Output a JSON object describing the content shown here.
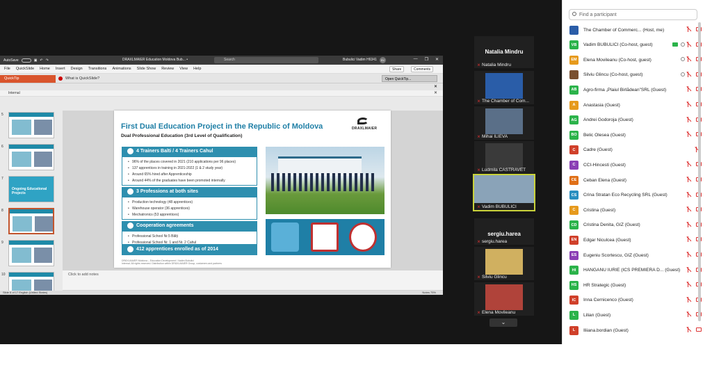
{
  "ppt": {
    "autosave": "AutoSave",
    "doc_title": "DRAXLMAIER Education Moldova Bub... •",
    "search": "Search",
    "user": "Bubulici Vadim H6341",
    "user_initials": "BV",
    "menu": [
      "File",
      "QuickSlide",
      "Home",
      "Insert",
      "Design",
      "Transitions",
      "Animations",
      "Slide Show",
      "Review",
      "View",
      "Help"
    ],
    "share": "Share",
    "comments": "Comments",
    "quicktip": "QuickTip",
    "quickslide_placeholder": "What is QuickSlide?",
    "open_quicktip": "Open QuickTip...",
    "sensitivity": "Internal",
    "notes_placeholder": "Click to add notes",
    "status_left": "Slide 6 of 17     English (United States)",
    "status_right": "Notes     75%",
    "thumbs": [
      {
        "num": "5"
      },
      {
        "num": "6"
      },
      {
        "num": "7",
        "text": "Ongoing Educational Projects"
      },
      {
        "num": "8"
      },
      {
        "num": "9"
      },
      {
        "num": "10"
      }
    ]
  },
  "slide": {
    "title": "First Dual Education Project in the Republic of Moldova",
    "subtitle": "Dual Professional Education (3rd Level of Qualification)",
    "logo": "DRAXLMAIER",
    "sec1": {
      "head": "4 Trainers Balti / 4 Trainers Cahul",
      "items": [
        "96% of the places covered in 2021 (210 applications per 96 places)",
        "137 apprentices in training in 2021-2022 (1 & 2 study year)",
        "Around 65% hired after Apprenticeship",
        "Around 44% of the graduates have been promoted internally"
      ]
    },
    "sec2": {
      "head": "3 Professions at both sites",
      "items": [
        "Production technology (48 apprentices)",
        "Warehouse operator (36 apprentices)",
        "Mechatronics (53 apprentices)"
      ]
    },
    "sec3": {
      "head": "Cooperation agreements",
      "items": [
        "Professional School Nr.5 Bălți",
        "Professional School Nr. 1 and Nr. 2 Cahul"
      ]
    },
    "sec4": {
      "head": "412 apprentices enrolled as of 2014"
    },
    "footer1": "DRÄXLMAIER Moldova – Education Development / Vadim Bubulici",
    "footer2": "Internal. All rights reserved. Distribution within DRÄXLMAIER Group, customers and partners"
  },
  "tiles": [
    {
      "type": "big",
      "label": "Natalia Mindru",
      "name": "Natalia Mindru"
    },
    {
      "type": "pic",
      "name": "The Chamber of Com...",
      "color": "#2a5da8"
    },
    {
      "type": "pic",
      "name": "Mihai ILIEVA",
      "color": "#5a6f88"
    },
    {
      "type": "pic",
      "name": "Ludmila CASTRAVET",
      "color": "#3a3a3a"
    },
    {
      "type": "pic",
      "name": "Vadim BUBULICI",
      "color": "#8aa3b8",
      "active": true
    },
    {
      "type": "big",
      "label": "sergiu.harea",
      "name": "sergiu.harea"
    },
    {
      "type": "pic",
      "name": "Silviu Glincu",
      "color": "#d0b060"
    },
    {
      "type": "pic",
      "name": "Elena Movileanu",
      "color": "#b0433a"
    }
  ],
  "panel": {
    "find_placeholder": "Find a participant",
    "participants": [
      {
        "initials": "",
        "color": "#2a5da8",
        "name": "The Chamber of Commerc... (Host, me)",
        "icons": [
          "mic",
          "cam"
        ]
      },
      {
        "initials": "VB",
        "color": "#2bb34a",
        "name": "Vadim BUBULICI (Co-host, guest)",
        "icons": [
          "gcam",
          "share",
          "mic",
          "cam"
        ]
      },
      {
        "initials": "EM",
        "color": "#e69a1c",
        "name": "Elena Movileanu (Co-host, guest)",
        "icons": [
          "share",
          "mic",
          "cam"
        ]
      },
      {
        "initials": "",
        "color": "#7a5030",
        "name": "Silviu Glincu (Co-host, guest)",
        "icons": [
          "share",
          "mic",
          "cam"
        ]
      },
      {
        "initials": "AB",
        "color": "#2bb34a",
        "name": "Agro-firma „Plaiul Birlădean”SRL (Guest)",
        "icons": [
          "mic",
          "cam"
        ]
      },
      {
        "initials": "A",
        "color": "#e69a1c",
        "name": "Anastasia (Guest)",
        "icons": [
          "mic",
          "cam"
        ]
      },
      {
        "initials": "AG",
        "color": "#2bb34a",
        "name": "Andrei Godoroja (Guest)",
        "icons": [
          "mic",
          "cam"
        ]
      },
      {
        "initials": "BO",
        "color": "#2bb34a",
        "name": "Belic Olesea (Guest)",
        "icons": [
          "mic",
          "cam"
        ]
      },
      {
        "initials": "C",
        "color": "#d0402a",
        "name": "Cadre (Guest)",
        "icons": [
          "mic"
        ]
      },
      {
        "initials": "C",
        "color": "#8b3fb5",
        "name": "CCI-Hincesti (Guest)",
        "icons": [
          "mic",
          "cam"
        ]
      },
      {
        "initials": "CE",
        "color": "#e07018",
        "name": "Ceban Elena (Guest)",
        "icons": [
          "mic",
          "cam"
        ]
      },
      {
        "initials": "CS",
        "color": "#2a8fc0",
        "name": "Crina Stratan Eco Recycling SRL (Guest)",
        "icons": [
          "mic",
          "cam"
        ]
      },
      {
        "initials": "C",
        "color": "#e69a1c",
        "name": "Cristina (Guest)",
        "icons": [
          "mic",
          "cam"
        ]
      },
      {
        "initials": "CD",
        "color": "#2bb34a",
        "name": "Cristina Denita, GIZ (Guest)",
        "icons": [
          "mic",
          "cam"
        ]
      },
      {
        "initials": "EN",
        "color": "#d0402a",
        "name": "Edgar Niculcea (Guest)",
        "icons": [
          "mic",
          "cam"
        ]
      },
      {
        "initials": "ES",
        "color": "#8b3fb5",
        "name": "Eugeniu Scortescu, GIZ (Guest)",
        "icons": [
          "mic",
          "cam"
        ]
      },
      {
        "initials": "HI",
        "color": "#2bb34a",
        "name": "HANGANU IURIE (ICS PREMIERA D... (Guest)",
        "icons": [
          "mic",
          "cam"
        ]
      },
      {
        "initials": "HS",
        "color": "#2bb34a",
        "name": "HR Strategic (Guest)",
        "icons": [
          "mic",
          "cam"
        ]
      },
      {
        "initials": "IC",
        "color": "#d0402a",
        "name": "Inna Cernicenco (Guest)",
        "icons": [
          "mic",
          "cam"
        ]
      },
      {
        "initials": "L",
        "color": "#2bb34a",
        "name": "Lilian (Guest)",
        "icons": [
          "mic",
          "cam"
        ]
      },
      {
        "initials": "L",
        "color": "#d0402a",
        "name": "Iliiana.bordian (Guest)",
        "icons": [
          "mic",
          "cam"
        ]
      }
    ]
  }
}
